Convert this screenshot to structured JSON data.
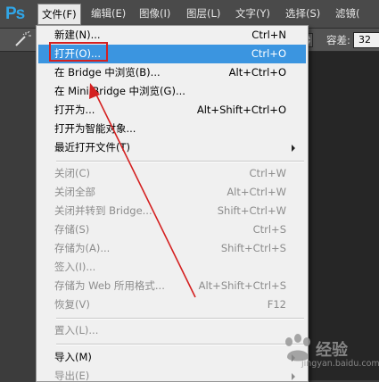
{
  "app": {
    "logo": "Ps"
  },
  "menubar": {
    "items": [
      {
        "label": "文件(F)"
      },
      {
        "label": "编辑(E)"
      },
      {
        "label": "图像(I)"
      },
      {
        "label": "图层(L)"
      },
      {
        "label": "文字(Y)"
      },
      {
        "label": "选择(S)"
      },
      {
        "label": "滤镜("
      }
    ]
  },
  "options": {
    "tolerance_label": "容差:",
    "tolerance_value": "32"
  },
  "file_menu": {
    "items": [
      {
        "label": "新建(N)...",
        "shortcut": "Ctrl+N",
        "disabled": false
      },
      {
        "label": "打开(O)...",
        "shortcut": "Ctrl+O",
        "disabled": false,
        "highlighted": true
      },
      {
        "label": "在 Bridge 中浏览(B)...",
        "shortcut": "Alt+Ctrl+O",
        "disabled": false
      },
      {
        "label": "在 Mini Bridge 中浏览(G)...",
        "shortcut": "",
        "disabled": false
      },
      {
        "label": "打开为...",
        "shortcut": "Alt+Shift+Ctrl+O",
        "disabled": false
      },
      {
        "label": "打开为智能对象...",
        "shortcut": "",
        "disabled": false
      },
      {
        "label": "最近打开文件(T)",
        "shortcut": "",
        "disabled": false,
        "submenu": true
      },
      {
        "label": "关闭(C)",
        "shortcut": "Ctrl+W",
        "disabled": true
      },
      {
        "label": "关闭全部",
        "shortcut": "Alt+Ctrl+W",
        "disabled": true
      },
      {
        "label": "关闭并转到 Bridge...",
        "shortcut": "Shift+Ctrl+W",
        "disabled": true
      },
      {
        "label": "存储(S)",
        "shortcut": "Ctrl+S",
        "disabled": true
      },
      {
        "label": "存储为(A)...",
        "shortcut": "Shift+Ctrl+S",
        "disabled": true
      },
      {
        "label": "签入(I)...",
        "shortcut": "",
        "disabled": true
      },
      {
        "label": "存储为 Web 所用格式...",
        "shortcut": "Alt+Shift+Ctrl+S",
        "disabled": true
      },
      {
        "label": "恢复(V)",
        "shortcut": "F12",
        "disabled": true
      },
      {
        "label": "置入(L)...",
        "shortcut": "",
        "disabled": true
      },
      {
        "label": "导入(M)",
        "shortcut": "",
        "disabled": false,
        "submenu": true
      },
      {
        "label": "导出(E)",
        "shortcut": "",
        "disabled": true,
        "submenu": true
      }
    ]
  },
  "watermark": {
    "text": "经验",
    "url": "jingyan.baidu.com"
  },
  "colors": {
    "highlight": "#3b95e0",
    "annotation_red": "#d42020",
    "ps_blue": "#30a6e8"
  }
}
